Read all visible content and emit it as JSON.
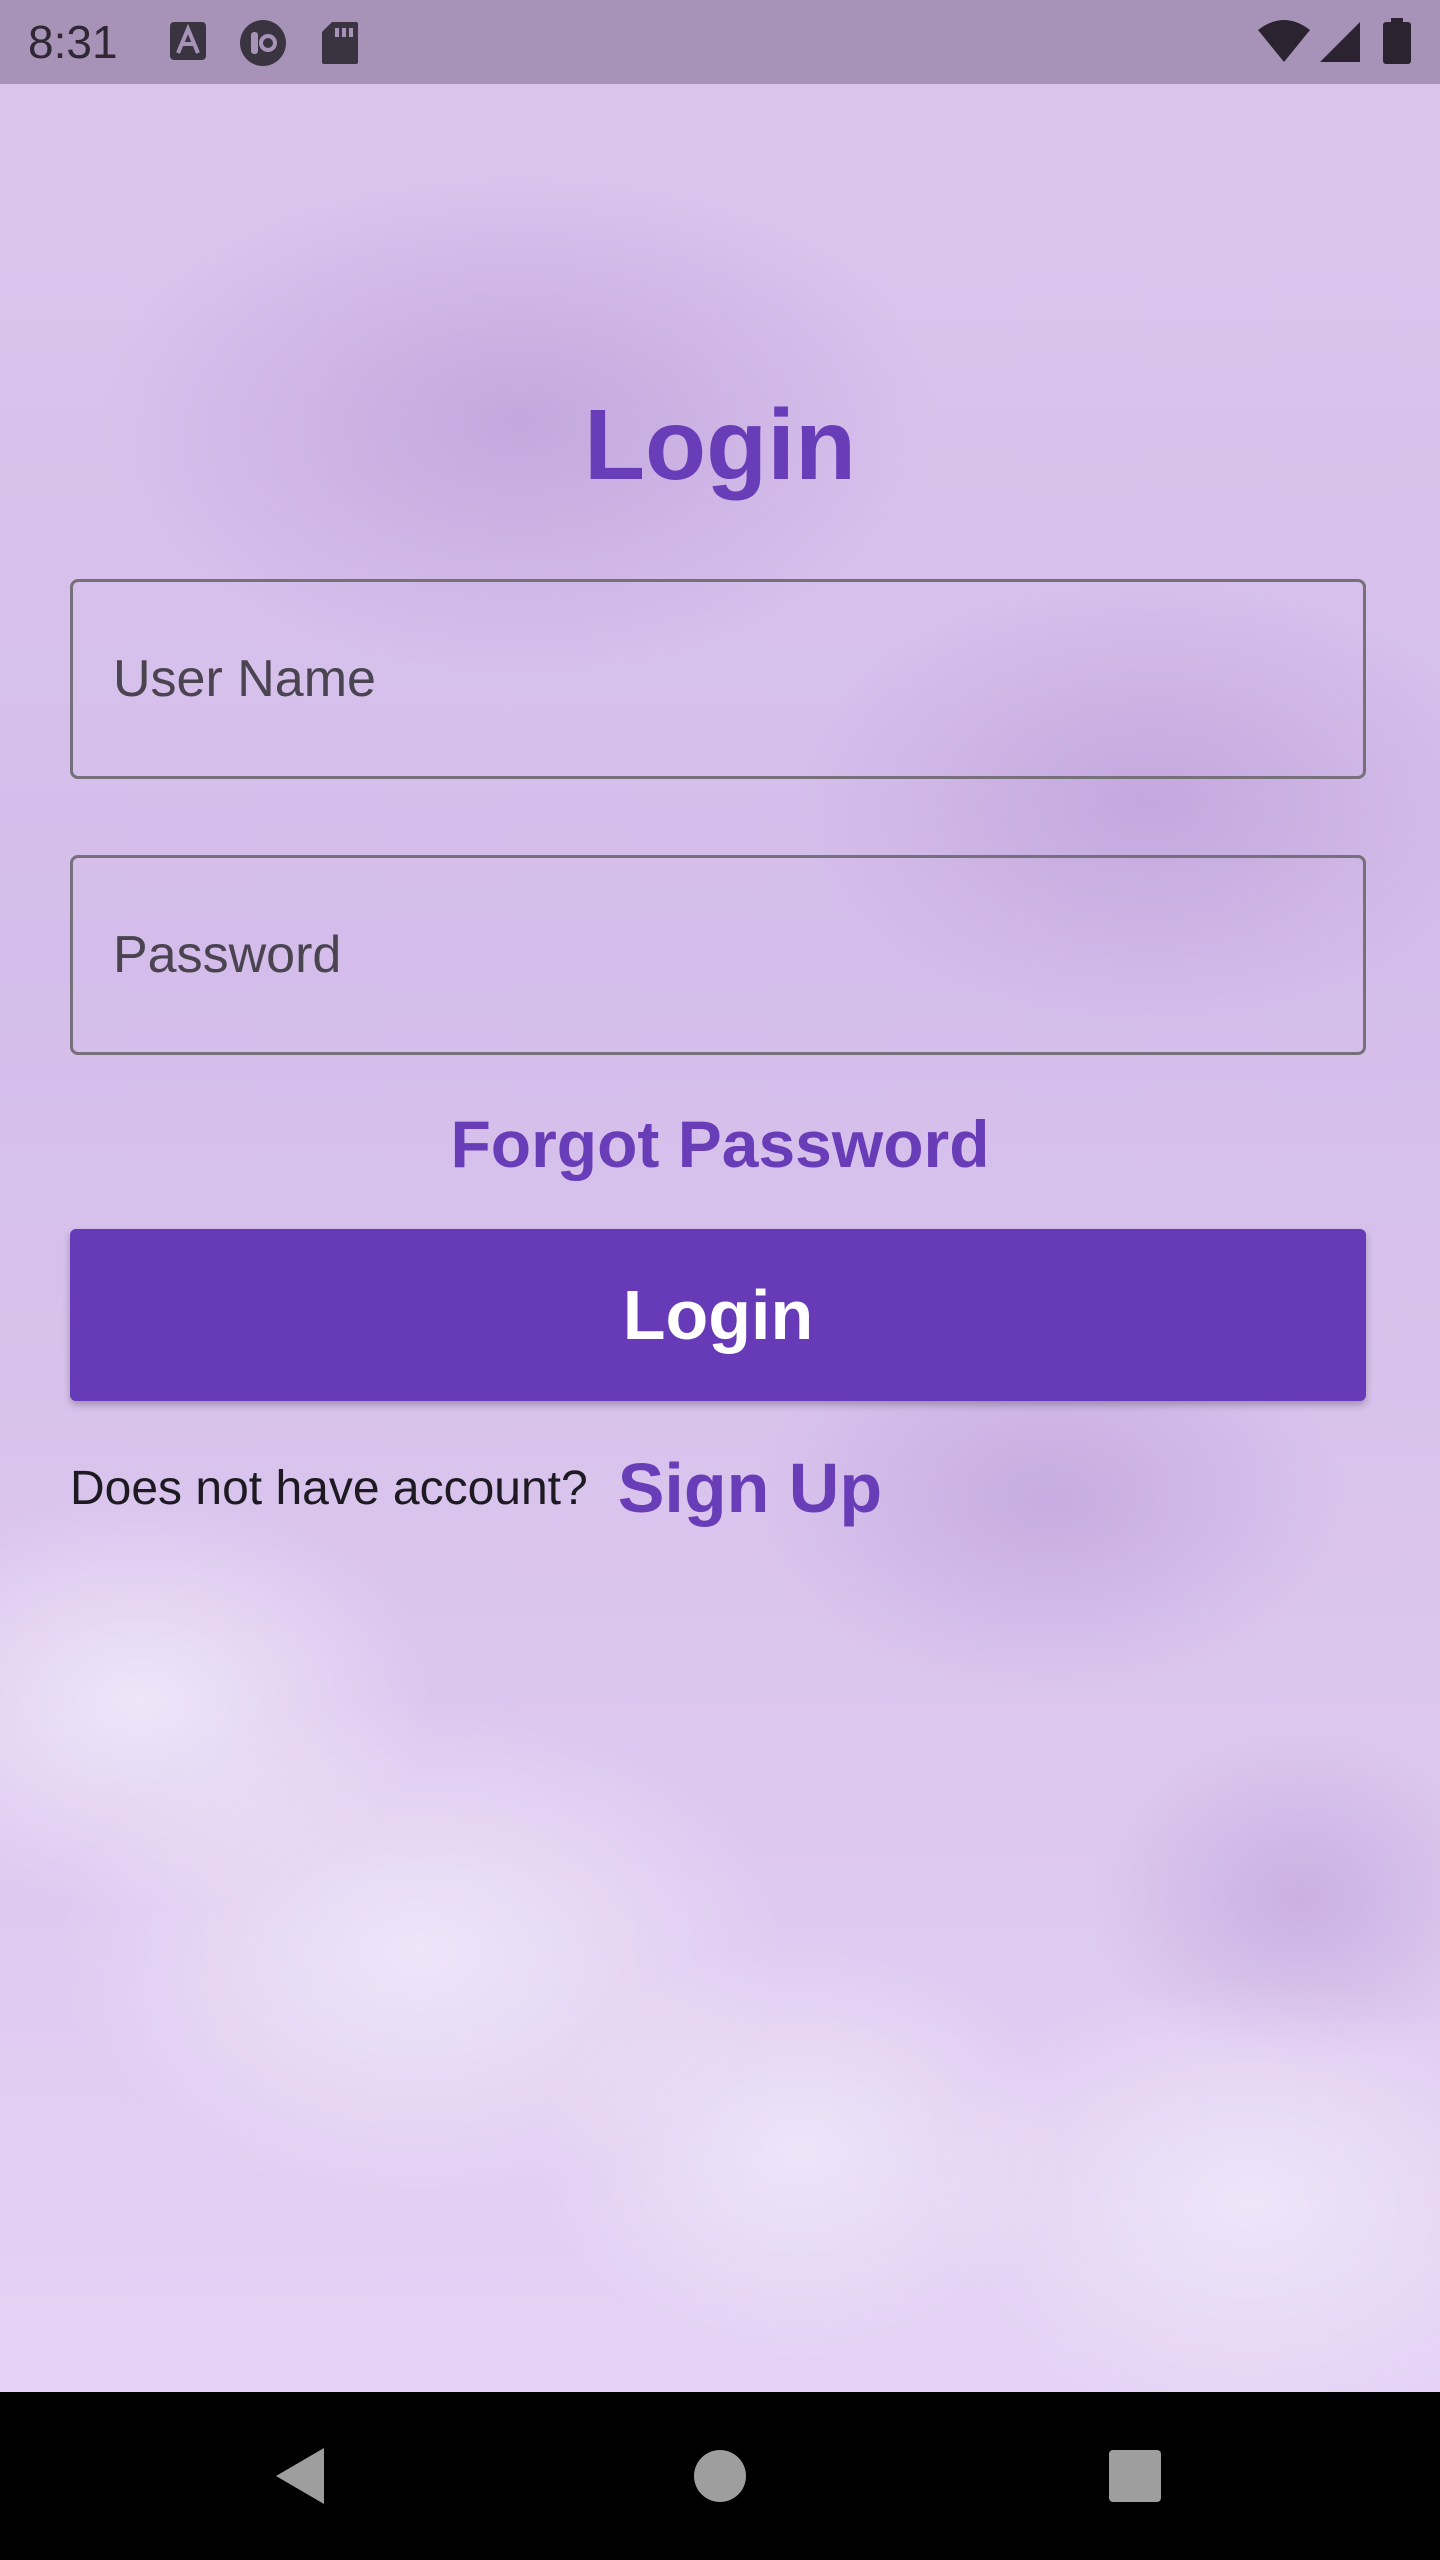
{
  "status_bar": {
    "time": "8:31",
    "left_icons": [
      "font-a-icon",
      "circle-app-icon",
      "sd-card-icon"
    ],
    "right_icons": [
      "wifi-icon",
      "signal-icon",
      "battery-icon"
    ]
  },
  "page": {
    "title": "Login"
  },
  "form": {
    "username_placeholder": "User Name",
    "username_value": "",
    "password_placeholder": "Password",
    "password_value": ""
  },
  "links": {
    "forgot_password": "Forgot Password",
    "signup_question": "Does not have account?",
    "signup": "Sign Up"
  },
  "buttons": {
    "login": "Login"
  },
  "nav_bar": {
    "buttons": [
      "back-icon",
      "home-icon",
      "recents-icon"
    ]
  },
  "colors": {
    "accent": "#673ab7",
    "accent_text": "#6a3db8",
    "background": "#dcc6ef",
    "status_bar": "#a893b8",
    "nav_bar": "#000000"
  }
}
